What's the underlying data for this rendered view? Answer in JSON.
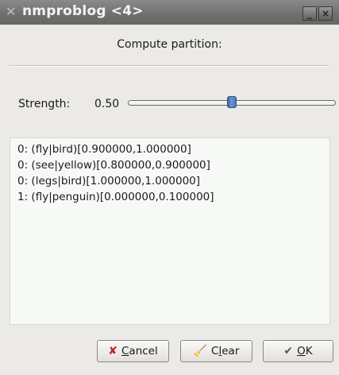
{
  "window": {
    "title": "nmproblog <4>",
    "app_icon": "x-logo-icon",
    "minimize_label": "_",
    "close_label": "×"
  },
  "heading": "Compute partition:",
  "strength": {
    "label": "Strength:",
    "value": "0.50",
    "fraction": 0.5
  },
  "results": [
    "0: (fly|bird)[0.900000,1.000000]",
    "0: (see|yellow)[0.800000,0.900000]",
    "0: (legs|bird)[1.000000,1.000000]",
    "1: (fly|penguin)[0.000000,0.100000]"
  ],
  "buttons": {
    "cancel": {
      "label": "Cancel",
      "mnemonic": "C",
      "rest": "ancel",
      "icon": "cross-icon"
    },
    "clear": {
      "label": "Clear",
      "pre": "C",
      "mnemonic": "l",
      "rest": "ear",
      "icon": "broom-icon"
    },
    "ok": {
      "label": "OK",
      "mnemonic": "O",
      "rest": "K",
      "icon": "checkmark-icon"
    }
  },
  "colors": {
    "titlebar": "#6f6f6f",
    "background": "#eceae6",
    "list_background": "#f6f9f6",
    "slider_thumb": "#4a72b6"
  }
}
